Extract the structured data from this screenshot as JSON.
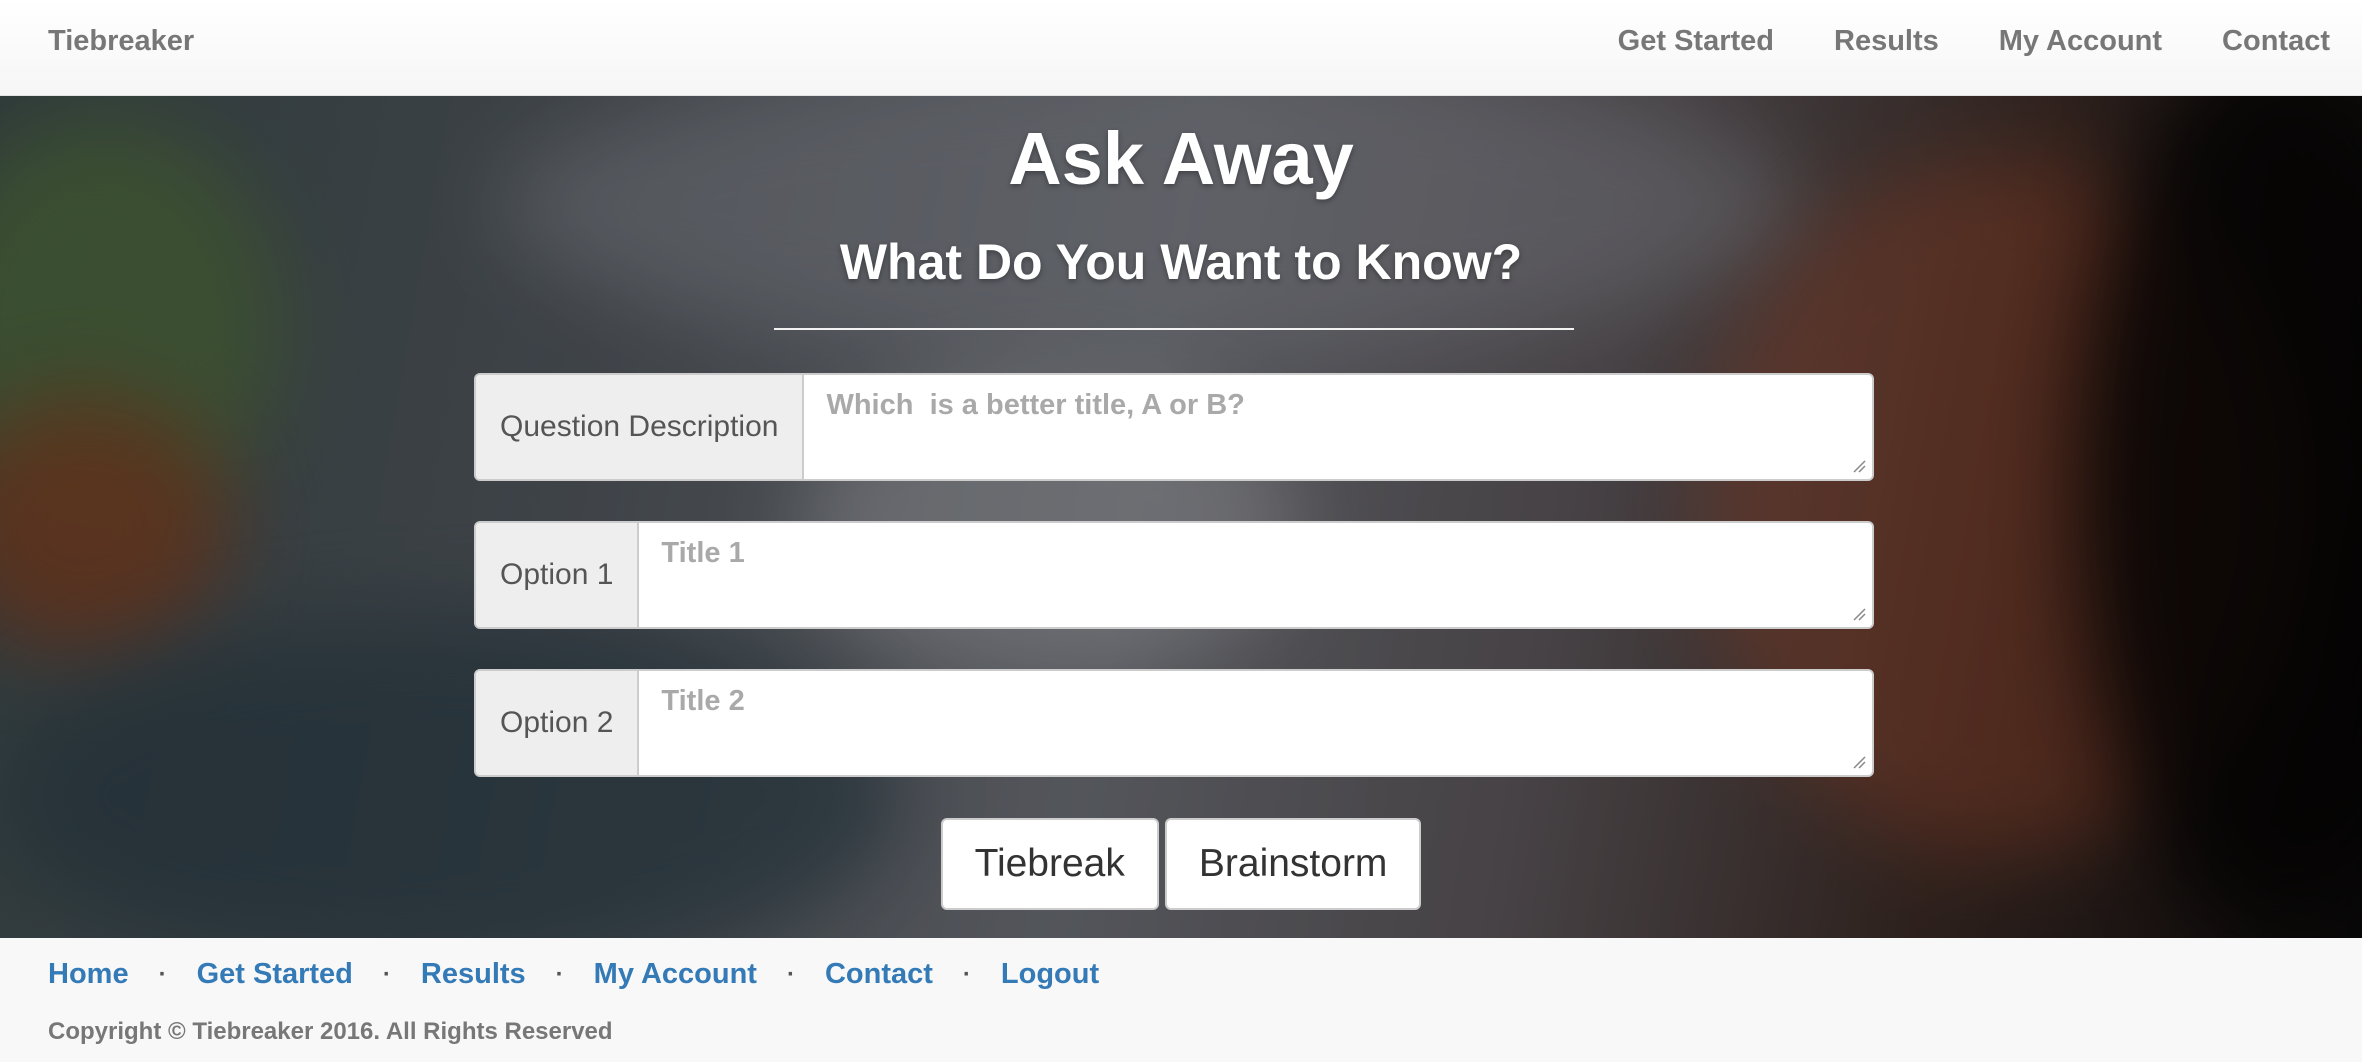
{
  "navbar": {
    "brand": "Tiebreaker",
    "links": [
      "Get Started",
      "Results",
      "My Account",
      "Contact"
    ]
  },
  "hero": {
    "title": "Ask Away",
    "subtitle": "What Do You Want to Know?"
  },
  "form": {
    "question": {
      "label": "Question Description",
      "placeholder": "Which  is a better title, A or B?",
      "value": ""
    },
    "option1": {
      "label": "Option 1",
      "placeholder": "Title 1",
      "value": ""
    },
    "option2": {
      "label": "Option 2",
      "placeholder": "Title 2",
      "value": ""
    },
    "buttons": {
      "tiebreak": "Tiebreak",
      "brainstorm": "Brainstorm"
    }
  },
  "footer": {
    "links": [
      "Home",
      "Get Started",
      "Results",
      "My Account",
      "Contact",
      "Logout"
    ],
    "separator": "·",
    "copyright": "Copyright © Tiebreaker 2016. All Rights Reserved"
  },
  "colors": {
    "link_blue": "#337ab7",
    "nav_gray": "#777777",
    "addon_bg": "#eeeeee",
    "border": "#cccccc"
  }
}
